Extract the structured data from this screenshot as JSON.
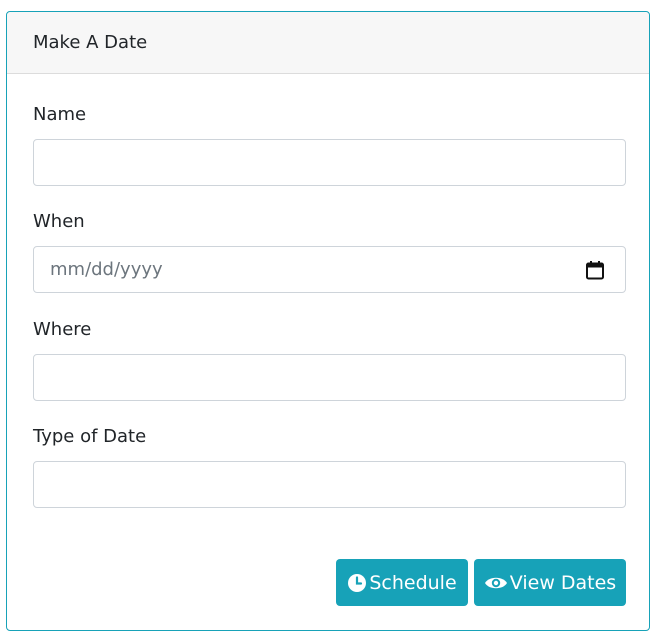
{
  "form": {
    "title": "Make A Date",
    "fields": [
      {
        "label": "Name",
        "value": ""
      },
      {
        "label": "When",
        "placeholder": "mm/dd/yyyy"
      },
      {
        "label": "Where",
        "value": ""
      },
      {
        "label": "Type of Date",
        "value": ""
      }
    ]
  },
  "buttons": {
    "schedule_label": "Schedule",
    "view_label": "View Dates"
  },
  "colors": {
    "accent": "#17a2b8",
    "header_bg": "#f7f7f7",
    "input_border": "#ced4da"
  },
  "icons": {
    "date_field": "calendar-icon",
    "schedule": "clock-icon",
    "view": "eye-icon"
  }
}
